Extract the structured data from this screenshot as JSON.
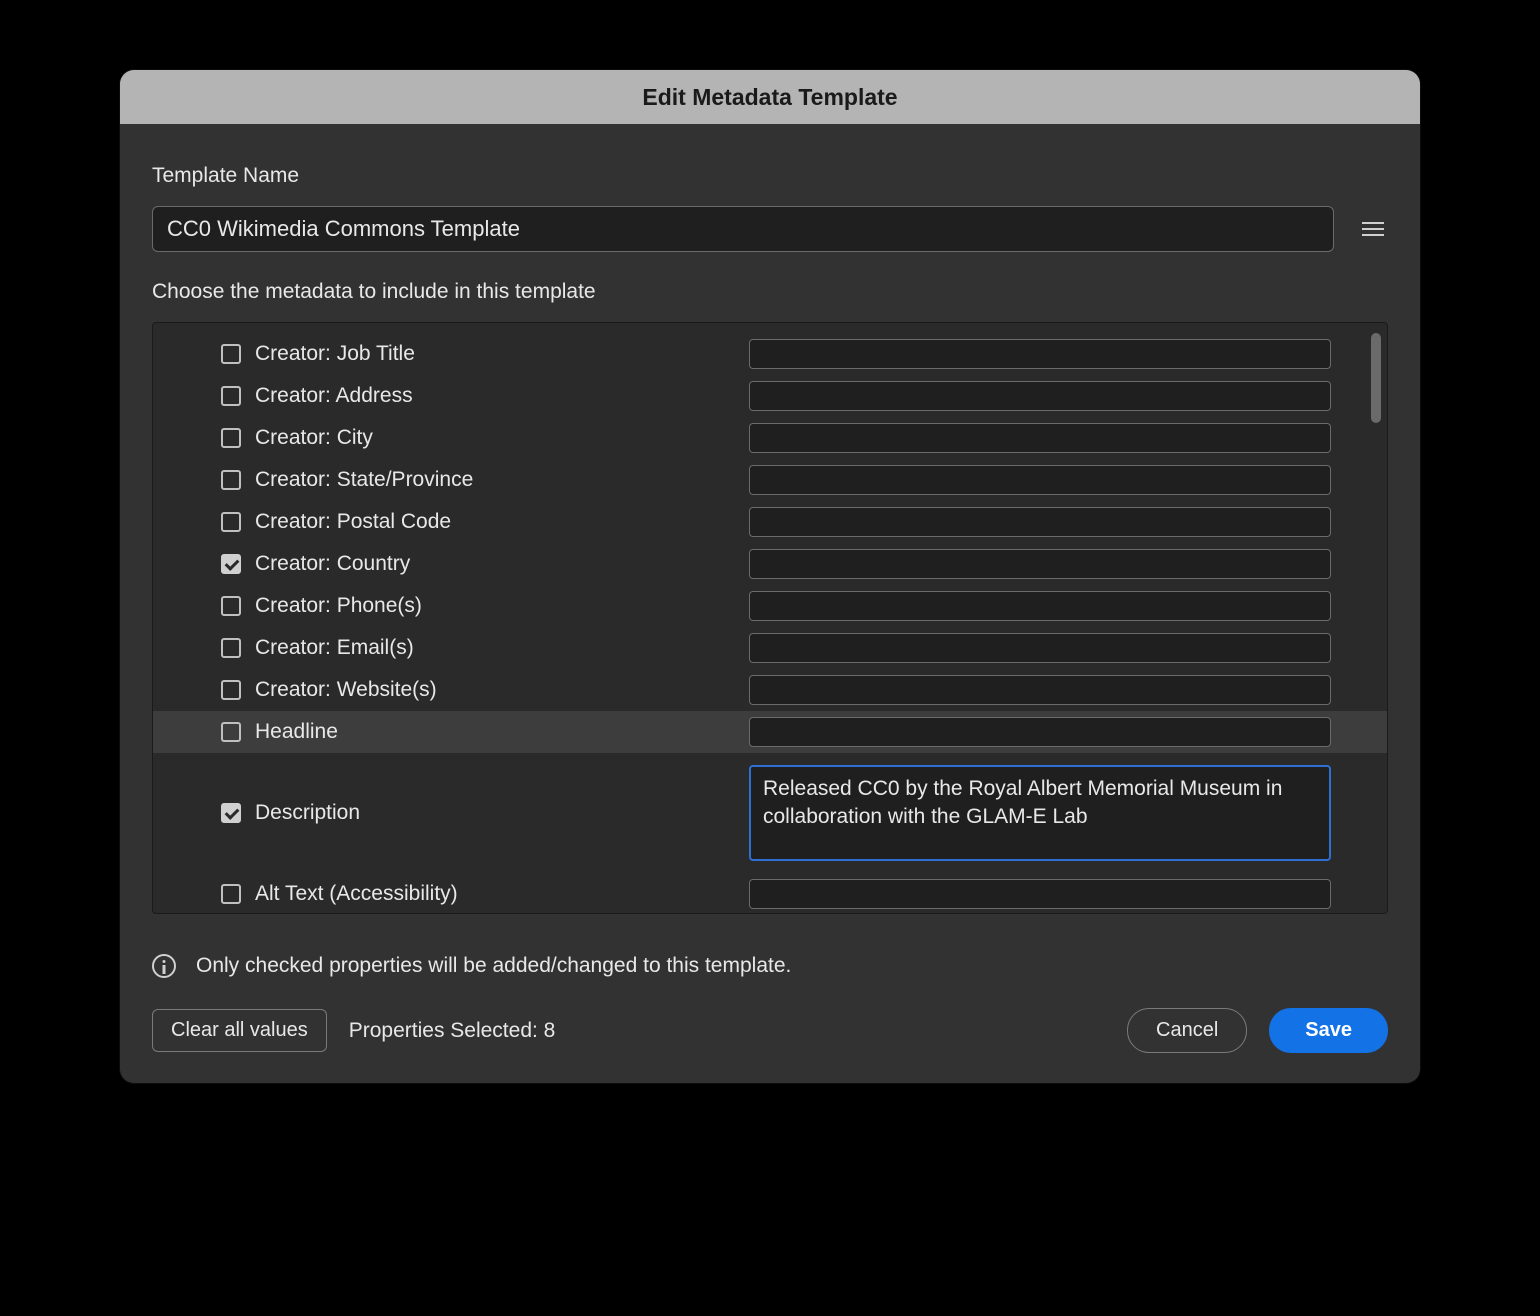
{
  "dialog": {
    "title": "Edit Metadata Template",
    "template_name_label": "Template Name",
    "template_name_value": "CC0 Wikimedia Commons Template",
    "choose_label": "Choose the metadata to include in this template",
    "info_text": "Only checked properties will be added/changed to this template.",
    "clear_button": "Clear all values",
    "properties_selected": "Properties Selected: 8",
    "cancel_button": "Cancel",
    "save_button": "Save"
  },
  "fields": [
    {
      "label": "Creator: Job Title",
      "checked": false,
      "value": "",
      "type": "text"
    },
    {
      "label": "Creator: Address",
      "checked": false,
      "value": "",
      "type": "text"
    },
    {
      "label": "Creator: City",
      "checked": false,
      "value": "",
      "type": "text"
    },
    {
      "label": "Creator: State/Province",
      "checked": false,
      "value": "",
      "type": "text"
    },
    {
      "label": "Creator: Postal Code",
      "checked": false,
      "value": "",
      "type": "text"
    },
    {
      "label": "Creator: Country",
      "checked": true,
      "value": "",
      "type": "text"
    },
    {
      "label": "Creator: Phone(s)",
      "checked": false,
      "value": "",
      "type": "text"
    },
    {
      "label": "Creator: Email(s)",
      "checked": false,
      "value": "",
      "type": "text"
    },
    {
      "label": "Creator: Website(s)",
      "checked": false,
      "value": "",
      "type": "text"
    },
    {
      "label": "Headline",
      "checked": false,
      "value": "",
      "type": "text",
      "highlight": true
    },
    {
      "label": "Description",
      "checked": true,
      "value": "Released CC0 by the Royal Albert Memorial Museum in collaboration with the GLAM-E Lab",
      "type": "textarea"
    },
    {
      "label": "Alt Text (Accessibility)",
      "checked": false,
      "value": "",
      "type": "text"
    }
  ]
}
